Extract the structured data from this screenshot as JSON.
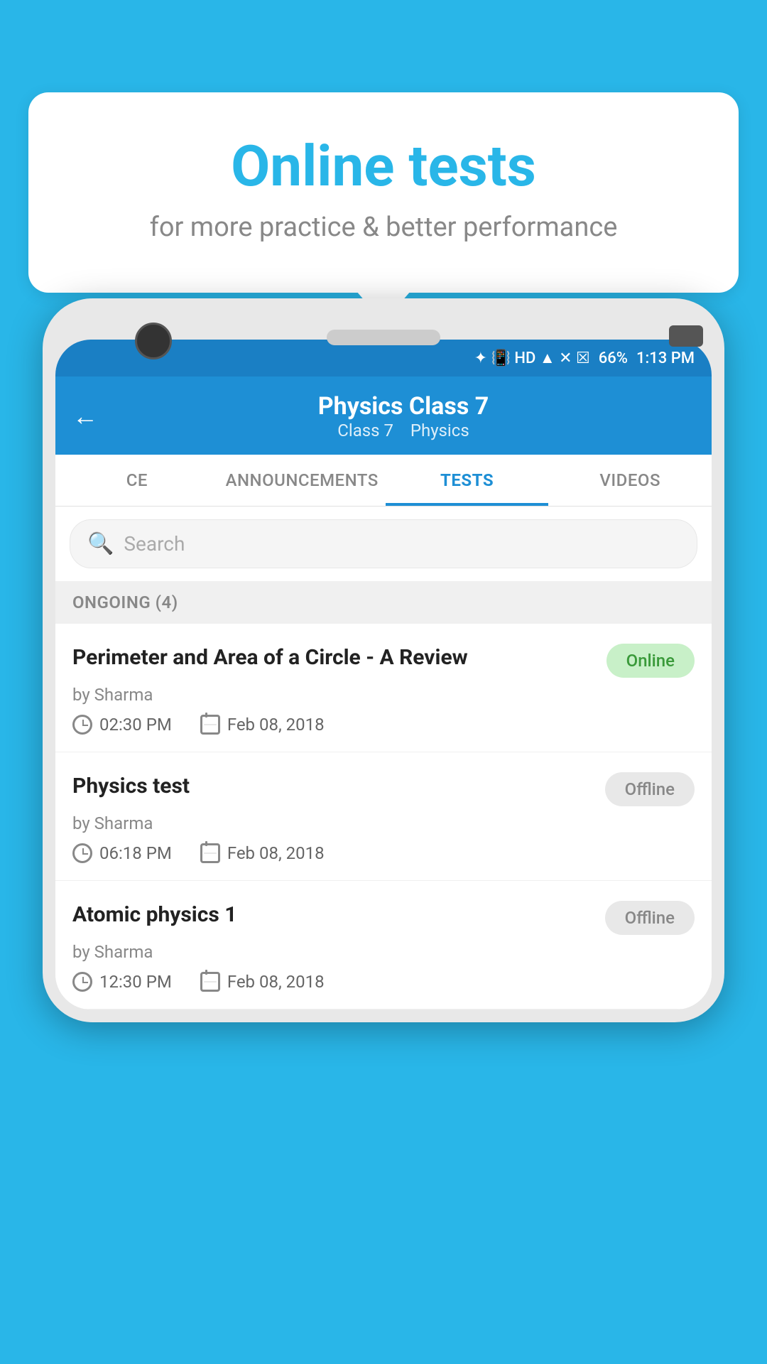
{
  "background_color": "#29b6e8",
  "tooltip": {
    "title": "Online tests",
    "subtitle": "for more practice & better performance"
  },
  "phone": {
    "status_bar": {
      "battery_percent": "66%",
      "time": "1:13 PM"
    },
    "header": {
      "title": "Physics Class 7",
      "subtitle_class": "Class 7",
      "subtitle_subject": "Physics",
      "back_label": "←"
    },
    "tabs": [
      {
        "label": "CE",
        "active": false
      },
      {
        "label": "ANNOUNCEMENTS",
        "active": false
      },
      {
        "label": "TESTS",
        "active": true
      },
      {
        "label": "VIDEOS",
        "active": false
      }
    ],
    "search": {
      "placeholder": "Search"
    },
    "section": {
      "title": "ONGOING (4)"
    },
    "tests": [
      {
        "name": "Perimeter and Area of a Circle - A Review",
        "status": "Online",
        "status_type": "online",
        "author": "by Sharma",
        "time": "02:30 PM",
        "date": "Feb 08, 2018"
      },
      {
        "name": "Physics test",
        "status": "Offline",
        "status_type": "offline",
        "author": "by Sharma",
        "time": "06:18 PM",
        "date": "Feb 08, 2018"
      },
      {
        "name": "Atomic physics 1",
        "status": "Offline",
        "status_type": "offline",
        "author": "by Sharma",
        "time": "12:30 PM",
        "date": "Feb 08, 2018"
      }
    ]
  }
}
